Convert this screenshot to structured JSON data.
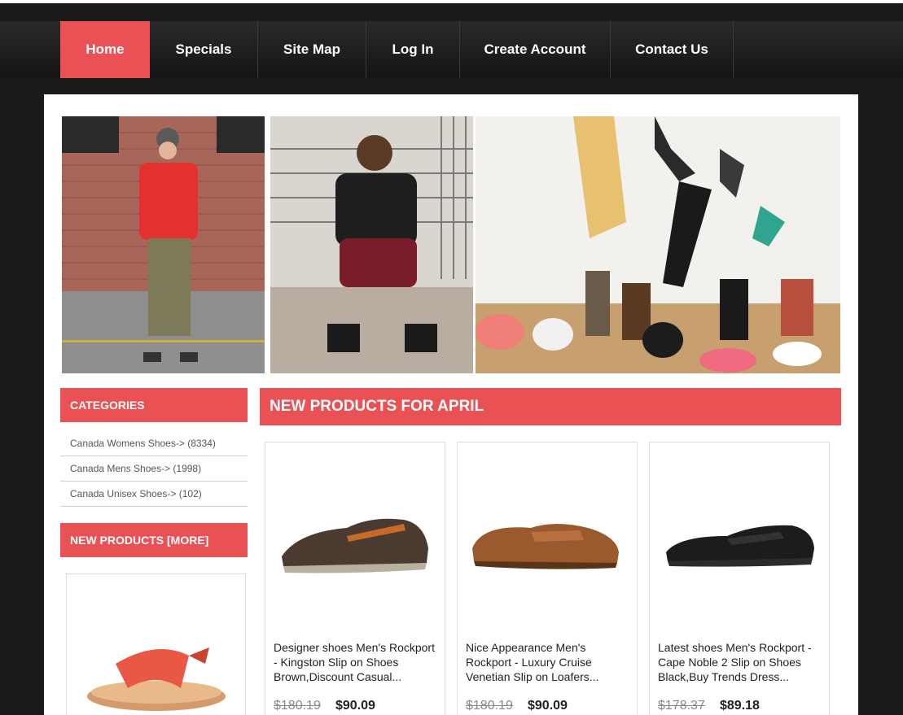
{
  "nav": {
    "items": [
      {
        "label": "Home",
        "active": true
      },
      {
        "label": "Specials"
      },
      {
        "label": "Site Map"
      },
      {
        "label": "Log In"
      },
      {
        "label": "Create Account"
      },
      {
        "label": "Contact Us"
      }
    ]
  },
  "sidebar": {
    "categories_title": "CATEGORIES",
    "categories": [
      "Canada Womens Shoes-> (8334)",
      "Canada Mens Shoes-> (1998)",
      "Canada Unisex Shoes-> (102)"
    ],
    "new_products_title": "NEW PRODUCTS  [MORE]"
  },
  "main": {
    "title": "NEW PRODUCTS FOR APRIL",
    "products": [
      {
        "title": "Designer shoes Men's Rockport - Kingston Slip on Shoes Brown,Discount Casual...",
        "old_price": "$180.19",
        "price": "$90.09"
      },
      {
        "title": "Nice Appearance Men's Rockport - Luxury Cruise Venetian Slip on Loafers...",
        "old_price": "$180.19",
        "price": "$90.09"
      },
      {
        "title": "Latest shoes Men's Rockport - Cape Noble 2 Slip on Shoes Black,Buy Trends Dress...",
        "old_price": "$178.37",
        "price": "$89.18"
      }
    ]
  },
  "colors": {
    "accent": "#ea5155",
    "background": "#1b1b1b"
  }
}
